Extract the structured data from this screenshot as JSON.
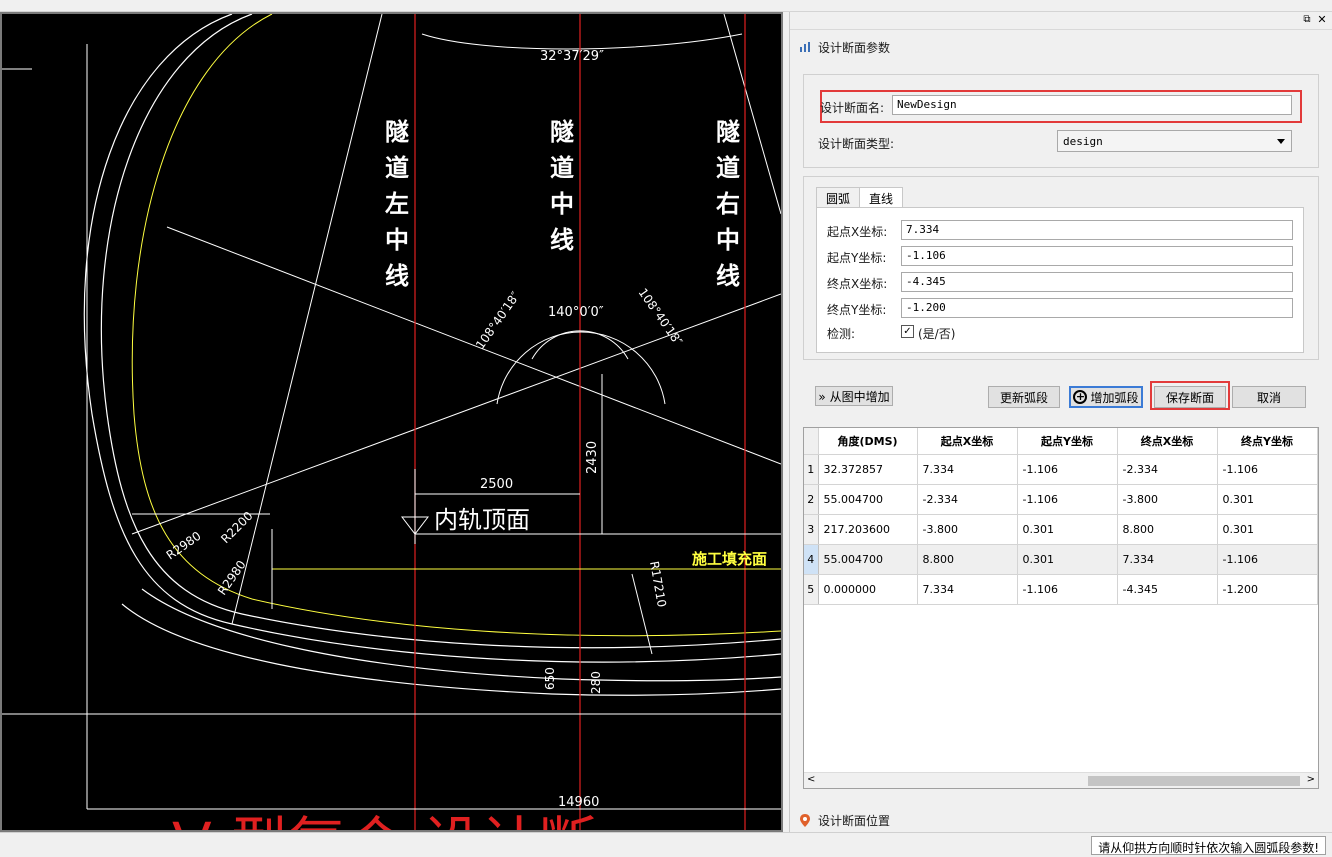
{
  "cad": {
    "labels": {
      "left_centerline": [
        "隧",
        "道",
        "左",
        "中",
        "线"
      ],
      "center_centerline": [
        "隧",
        "道",
        "中",
        "线"
      ],
      "right_centerline": [
        "隧",
        "道",
        "右",
        "中",
        "线"
      ],
      "top_angle": "32°37′29″",
      "arc_angle_center": "140°0′0″",
      "arc_angle_left": "108°40′18″",
      "arc_angle_right": "108°40′18″",
      "dim_2500": "2500",
      "dim_2430": "2430",
      "rail_top": "内轨顶面",
      "fill_label": "施工填充面",
      "r2980_a": "R2980",
      "r2200": "R2200",
      "r2980_b": "R2980",
      "r17210": "R17210",
      "dim_650": "650",
      "dim_280": "280",
      "dim_14960": "14960",
      "bottom_title": "V 型复合 设计断"
    },
    "colors": {
      "background": "#000000",
      "lines": "#ffffff",
      "centerlines": "#e02020",
      "fill_line": "#ffff40",
      "fill_label": "#ffff40",
      "bottom_title": "#e02020"
    }
  },
  "panel": {
    "pin_icon": "pin-icon",
    "close_icon": "close-icon",
    "section1_title": "设计断面参数",
    "name_label": "设计断面名:",
    "name_value": "NewDesign",
    "type_label": "设计断面类型:",
    "type_value": "design",
    "tabs": [
      "圆弧",
      "直线"
    ],
    "active_tab": "直线",
    "start_x_label": "起点X坐标:",
    "start_x_value": "7.334",
    "start_y_label": "起点Y坐标:",
    "start_y_value": "-1.106",
    "end_x_label": "终点X坐标:",
    "end_x_value": "-4.345",
    "end_y_label": "终点Y坐标:",
    "end_y_value": "-1.200",
    "check_label": "检测:",
    "check_text": "(是/否)",
    "check_mark": "✓",
    "buttons": {
      "from_drawing": "» 从图中增加",
      "update_arc": "更新弧段",
      "add_arc": "增加弧段",
      "add_arc_icon": "+",
      "save_section": "保存断面",
      "cancel": "取消"
    },
    "table": {
      "columns": [
        "角度(DMS)",
        "起点X坐标",
        "起点Y坐标",
        "终点X坐标",
        "终点Y坐标"
      ],
      "rows": [
        {
          "n": "1",
          "cells": [
            "32.372857",
            "7.334",
            "-1.106",
            "-2.334",
            "-1.106"
          ]
        },
        {
          "n": "2",
          "cells": [
            "55.004700",
            "-2.334",
            "-1.106",
            "-3.800",
            "0.301"
          ]
        },
        {
          "n": "3",
          "cells": [
            "217.203600",
            "-3.800",
            "0.301",
            "8.800",
            "0.301"
          ]
        },
        {
          "n": "4",
          "cells": [
            "55.004700",
            "8.800",
            "0.301",
            "7.334",
            "-1.106"
          ]
        },
        {
          "n": "5",
          "cells": [
            " 0.000000",
            "7.334",
            "-1.106",
            "-4.345",
            "-1.200"
          ]
        }
      ],
      "selected_row": "4"
    },
    "section2_title": "设计断面位置"
  },
  "status": {
    "message": "请从仰拱方向顺时针依次输入圆弧段参数!"
  }
}
